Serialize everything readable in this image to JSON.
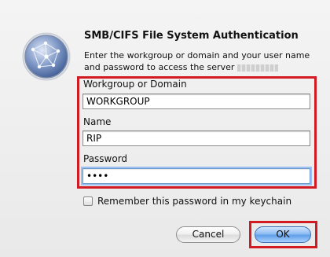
{
  "dialog": {
    "title": "SMB/CIFS File System Authentication",
    "message": "Enter the workgroup or domain and your user name and password to access the server",
    "icon": "network-globe-icon"
  },
  "fields": {
    "workgroup": {
      "label": "Workgroup or Domain",
      "value": "WORKGROUP"
    },
    "name": {
      "label": "Name",
      "value": "RIP"
    },
    "password": {
      "label": "Password",
      "value": "••••"
    }
  },
  "remember": {
    "label": "Remember this password in my keychain",
    "checked": false
  },
  "buttons": {
    "cancel": "Cancel",
    "ok": "OK"
  },
  "colors": {
    "highlight": "#d11a22",
    "default_button": "#5f9ee8",
    "background": "#ececec"
  }
}
